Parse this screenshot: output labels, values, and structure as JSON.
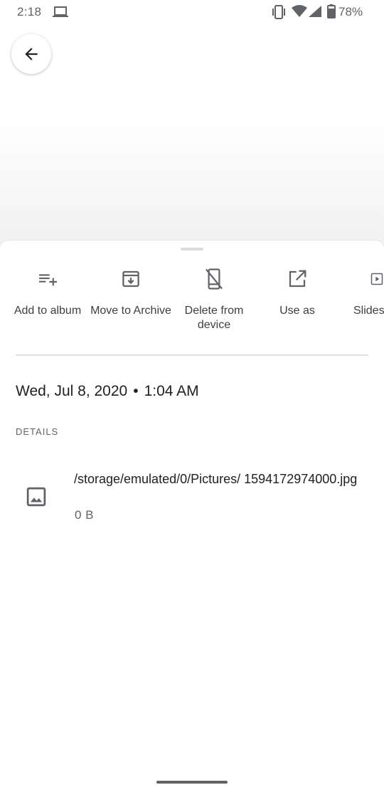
{
  "status_bar": {
    "time": "2:18",
    "battery": "78%"
  },
  "actions": [
    {
      "label": "Add to album",
      "icon": "playlist-add-icon"
    },
    {
      "label": "Move to Archive",
      "icon": "archive-icon"
    },
    {
      "label": "Delete from device",
      "icon": "mobile-off-icon"
    },
    {
      "label": "Use as",
      "icon": "open-in-new-icon"
    },
    {
      "label": "Slides",
      "icon": "slideshow-icon"
    }
  ],
  "info": {
    "date": "Wed, Jul 8, 2020",
    "separator": "•",
    "time": "1:04 AM",
    "details_header": "DETAILS",
    "file_path": "/storage/emulated/0/Pictures/ 1594172974000.jpg",
    "file_size": "0 B"
  },
  "colors": {
    "icon": "#5f6368",
    "text_primary": "#202124",
    "text_secondary": "#5f6368",
    "divider": "#e0e0e0"
  }
}
